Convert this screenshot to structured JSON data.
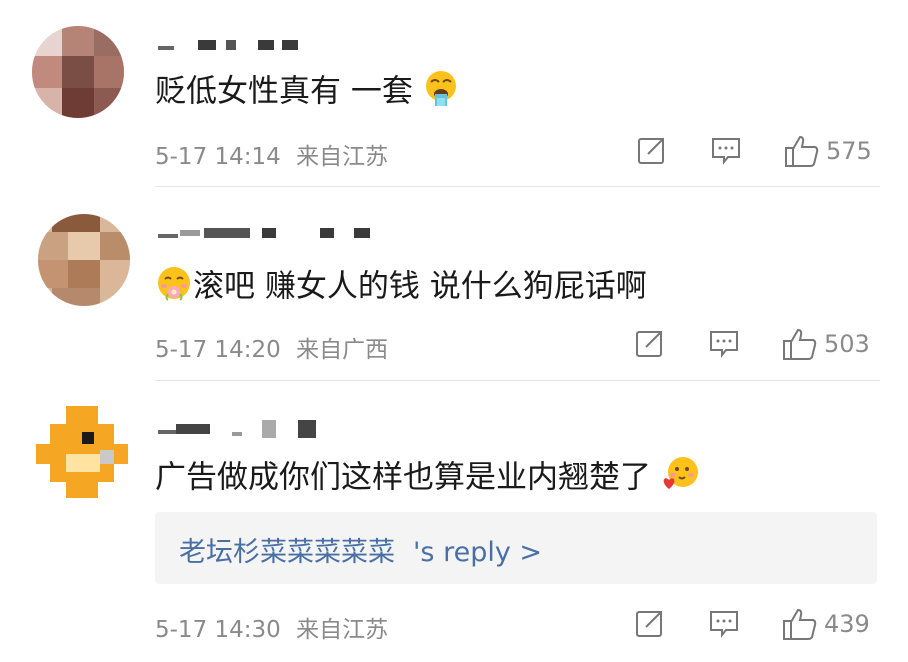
{
  "comments": [
    {
      "text": "贬低女性真有 一套",
      "emoji_after": "vomit-emoji",
      "date": "5-17 14:14",
      "location": "来自江苏",
      "likes": "575"
    },
    {
      "emoji_before": "flower-smile-emoji",
      "text": "滚吧 赚女人的钱 说什么狗屁话啊",
      "date": "5-17 14:20",
      "location": "来自广西",
      "likes": "503"
    },
    {
      "text": "广告做成你们这样也算是业内翘楚了",
      "emoji_after": "heart-blush-emoji",
      "reply": {
        "name": "老坛杉菜菜菜菜菜",
        "suffix": "'s reply >"
      },
      "date": "5-17 14:30",
      "location": "来自江苏",
      "likes": "439"
    }
  ],
  "icons": {
    "share": "share-icon",
    "comment": "comment-icon",
    "like": "thumbs-up-icon"
  },
  "colors": {
    "meta_gray": "#8a8a8a",
    "reply_link": "#4a6fa5",
    "reply_bg": "#f4f4f4"
  }
}
